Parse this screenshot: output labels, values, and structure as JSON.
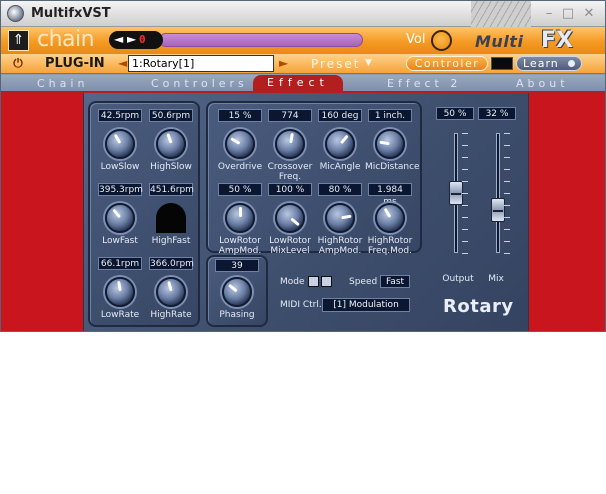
{
  "window": {
    "title": "MultifxVST"
  },
  "topbar": {
    "chain_title": "chain",
    "program_number": "0",
    "vol_label": "Vol",
    "logo_multi": "Multi",
    "logo_fx": "FX"
  },
  "plugbar": {
    "plugin_label": "PLUG-IN",
    "slot_value": "1:Rotary[1]",
    "preset_label": "Preset",
    "controler_label": "Controler",
    "learn_label": "Learn"
  },
  "tabs": [
    {
      "label": "Chain",
      "active": false
    },
    {
      "label": "Controlers",
      "active": false
    },
    {
      "label": "Effect",
      "active": true
    },
    {
      "label": "Effect 2",
      "active": false
    },
    {
      "label": "About",
      "active": false
    }
  ],
  "rotor_params": {
    "low_slow": {
      "value": "42.5rpm",
      "label": "LowSlow"
    },
    "high_slow": {
      "value": "50.6rpm",
      "label": "HighSlow"
    },
    "low_fast": {
      "value": "395.3rpm",
      "label": "LowFast"
    },
    "high_fast": {
      "value": "451.6rpm",
      "label": "HighFast"
    },
    "low_rate": {
      "value": "66.1rpm",
      "label": "LowRate"
    },
    "high_rate": {
      "value": "366.0rpm",
      "label": "HighRate"
    }
  },
  "amp_params": {
    "overdrive": {
      "value": "15 %",
      "label": "Overdrive"
    },
    "crossover": {
      "value": "774",
      "label": "Crossover Freq."
    },
    "mic_angle": {
      "value": "160 deg",
      "label": "MicAngle"
    },
    "mic_distance": {
      "value": "1 inch.",
      "label": "MicDistance"
    },
    "low_rotor_amp": {
      "value": "50 %",
      "label": "LowRotor AmpMod."
    },
    "low_rotor_mix": {
      "value": "100 %",
      "label": "LowRotor MixLevel"
    },
    "high_rotor_amp": {
      "value": "80 %",
      "label": "HighRotor AmpMod."
    },
    "high_rotor_freq": {
      "value": "1.984 ms",
      "label": "HighRotor Freq.Mod."
    }
  },
  "phasing": {
    "value": "39",
    "label": "Phasing"
  },
  "faders": {
    "output": {
      "value": "50 %",
      "label": "Output",
      "level": 0.5
    },
    "mix": {
      "value": "32 %",
      "label": "Mix",
      "level": 0.32
    }
  },
  "controls": {
    "mode_label": "Mode",
    "speed_label": "Speed",
    "speed_value": "Fast",
    "midi_label": "MIDI Ctrl.",
    "midi_value": "[1]  Modulation"
  },
  "effect_name": "Rotary"
}
